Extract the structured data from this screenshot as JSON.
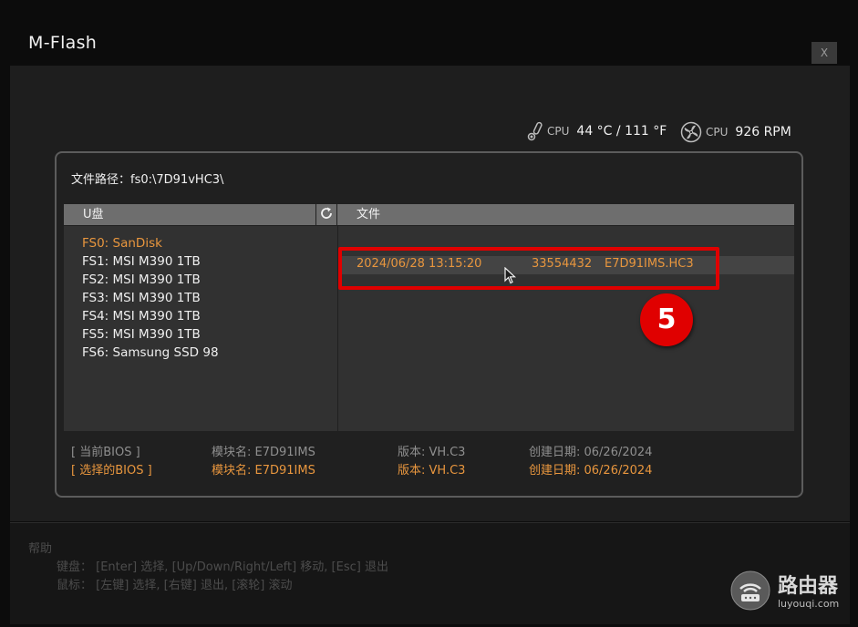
{
  "window": {
    "title": "M-Flash",
    "close_label": "X"
  },
  "sensors": {
    "cpu_temp": {
      "label": "CPU",
      "value": "44 °C / 111 °F",
      "icon": "thermometer-icon"
    },
    "cpu_fan": {
      "label": "CPU",
      "value": "926 RPM",
      "icon": "fan-icon"
    }
  },
  "file_path": {
    "label": "文件路径：",
    "value": "fs0:\\7D91vHC3\\"
  },
  "drives_panel": {
    "header": "U盘",
    "refresh_icon": "refresh-icon",
    "items": [
      {
        "label": "FS0: SanDisk",
        "selected": true
      },
      {
        "label": "FS1: MSI M390 1TB",
        "selected": false
      },
      {
        "label": "FS2: MSI M390 1TB",
        "selected": false
      },
      {
        "label": "FS3: MSI M390 1TB",
        "selected": false
      },
      {
        "label": "FS4: MSI M390 1TB",
        "selected": false
      },
      {
        "label": "FS5: MSI M390 1TB",
        "selected": false
      },
      {
        "label": "FS6: Samsung SSD 98",
        "selected": false
      }
    ]
  },
  "files_panel": {
    "header": "文件",
    "rows": [
      {
        "date": "2024/06/28 13:15:20",
        "size": "33554432",
        "name": "E7D91IMS.HC3"
      }
    ]
  },
  "annotation": {
    "step": "5",
    "color": "#e00000"
  },
  "bios_info": {
    "current": {
      "label": "[    当前BIOS    ]",
      "module": "模块名: E7D91IMS",
      "version": "版本: VH.C3",
      "date": "创建日期: 06/26/2024"
    },
    "selected": {
      "label": "[   选择的BIOS   ]",
      "module": "模块名: E7D91IMS",
      "version": "版本: VH.C3",
      "date": "创建日期: 06/26/2024"
    }
  },
  "help": {
    "title": "帮助",
    "keyboard": "键盘：  [Enter] 选择,  [Up/Down/Right/Left] 移动,  [Esc] 退出",
    "mouse": "鼠标：  [左键] 选择,  [右键] 退出,  [滚轮] 滚动"
  },
  "watermark": {
    "main": "路由器",
    "sub": "luyouqi.com"
  },
  "colors": {
    "accent": "#e8963e",
    "header_bg": "#6e6e6e",
    "highlight": "#e00000"
  }
}
